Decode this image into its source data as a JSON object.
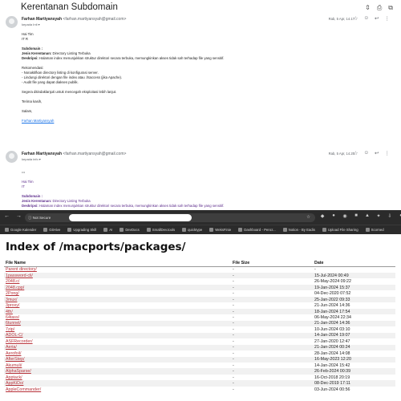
{
  "gmail": {
    "subject": "Kerentanan Subdomain",
    "messages": [
      {
        "sender_name": "Farhan Martiyansyah",
        "sender_email": "<farhan.martiyansyah@gmail.com>",
        "to": "kepada Inti ▾",
        "time": "Rab, 5 Apr, 14.17"
      },
      {
        "sender_name": "Farhan Martiyansyah",
        "sender_email": "<farhan.martiyansyah@gmail.com>",
        "to": "kepada info ▾",
        "time": "Rab, 5 Apr, 14.25"
      }
    ],
    "body1": {
      "greeting": "Hai Tim",
      "team": "IT R",
      "subdomain_label": "Subdomain :",
      "jenis_label": "Jenis Kerentanan:",
      "jenis_value": " Directory Listing Terbuka",
      "desc_label": "Deskripsi:",
      "desc_value": " Halaman index menunjukkan struktur direktori secara terbuka, memungkinkan akses tidak sah terhadap file yang sensitif.",
      "rekomendasi": "Rekomendasi:",
      "rec1": "- Nonaktifkan directory listing di konfigurasi server.",
      "rec2": "- Lindungi direktori dengan file index atau .htaccess (jika Apache).",
      "rec3": "- Audit file yang dapat diakses publik.",
      "followup": "Segera ditindaklanjuti untuk mencegah eksploitasi lebih lanjut.",
      "thanks": "Terima kasih,",
      "salam": "Salam,",
      "signature": "Farhan Martiyansyah"
    },
    "body2": {
      "ellipsis": "•••",
      "greeting": "Hai Tim",
      "team": "IT",
      "subdomain_label": "Subdomain :",
      "jenis_label": "Jenis Kerentanan:",
      "jenis_value": " Directory Listing Terbuka",
      "desc_label": "Deskripsi:",
      "desc_value": " Halaman index menunjukkan struktur direktori secara terbuka, memungkinkan akses tidak sah terhadap file yang sensitif."
    }
  },
  "browser": {
    "not_secure": "ⓘ Not Secure",
    "bookmarks": [
      "Google Kalender",
      "GitHive",
      "Upgrading Skill",
      "AI",
      "DevDocs",
      "SmallDev.tools",
      "quicktype",
      "WeksFinie",
      "Dashboard - Pencr...",
      "Notion - By Eadis",
      "Upload File Sharing",
      "Scorned"
    ]
  },
  "page": {
    "title": "Index of /macports/packages/",
    "headers": [
      "File Name",
      "File Size",
      "Date"
    ],
    "rows": [
      [
        "Parent directory/",
        "-",
        "-"
      ],
      [
        "1password-cli/",
        "-",
        "15-Jul-2024 00:49"
      ],
      [
        "2048.c/",
        "-",
        "26-May-2024 09:22"
      ],
      [
        "2048.cpp/",
        "-",
        "19-Jan-2024 15:37"
      ],
      [
        "2Pong/",
        "-",
        "04-Dec-2020 07:52"
      ],
      [
        "3mux/",
        "-",
        "25-Jan-2022 09:33"
      ],
      [
        "3proxy/",
        "-",
        "21-Jun-2024 14:36"
      ],
      [
        "4th/",
        "-",
        "18-Jan-2024 17:54"
      ],
      [
        "64tass/",
        "-",
        "06-May-2024 22:34"
      ],
      [
        "6tunnel/",
        "-",
        "21-Jan-2024 14:36"
      ],
      [
        "7zip/",
        "-",
        "10-Jun-2024 03:10"
      ],
      [
        "ADOL-C/",
        "-",
        "14-Jan-2024 19:07"
      ],
      [
        "ASFRecorder/",
        "-",
        "27-Jan-2020 12:47"
      ],
      [
        "Aeria/",
        "-",
        "21-Jan-2024 00:24"
      ],
      [
        "Aerofoil/",
        "-",
        "28-Jan-2024 14:08"
      ],
      [
        "AfterStep/",
        "-",
        "16-May-2023 12:20"
      ],
      [
        "Akumuli/",
        "-",
        "14-Jan-2024 15:42"
      ],
      [
        "AlphaSparse/",
        "-",
        "26-Feb-2024 00:39"
      ],
      [
        "Apptack/",
        "-",
        "16-Oct-2018 20:19"
      ],
      [
        "AppKiDo/",
        "-",
        "08-Dec-2019 17:11"
      ],
      [
        "AppleCommander/",
        "-",
        "03-Jun-2024 00:56"
      ]
    ]
  }
}
